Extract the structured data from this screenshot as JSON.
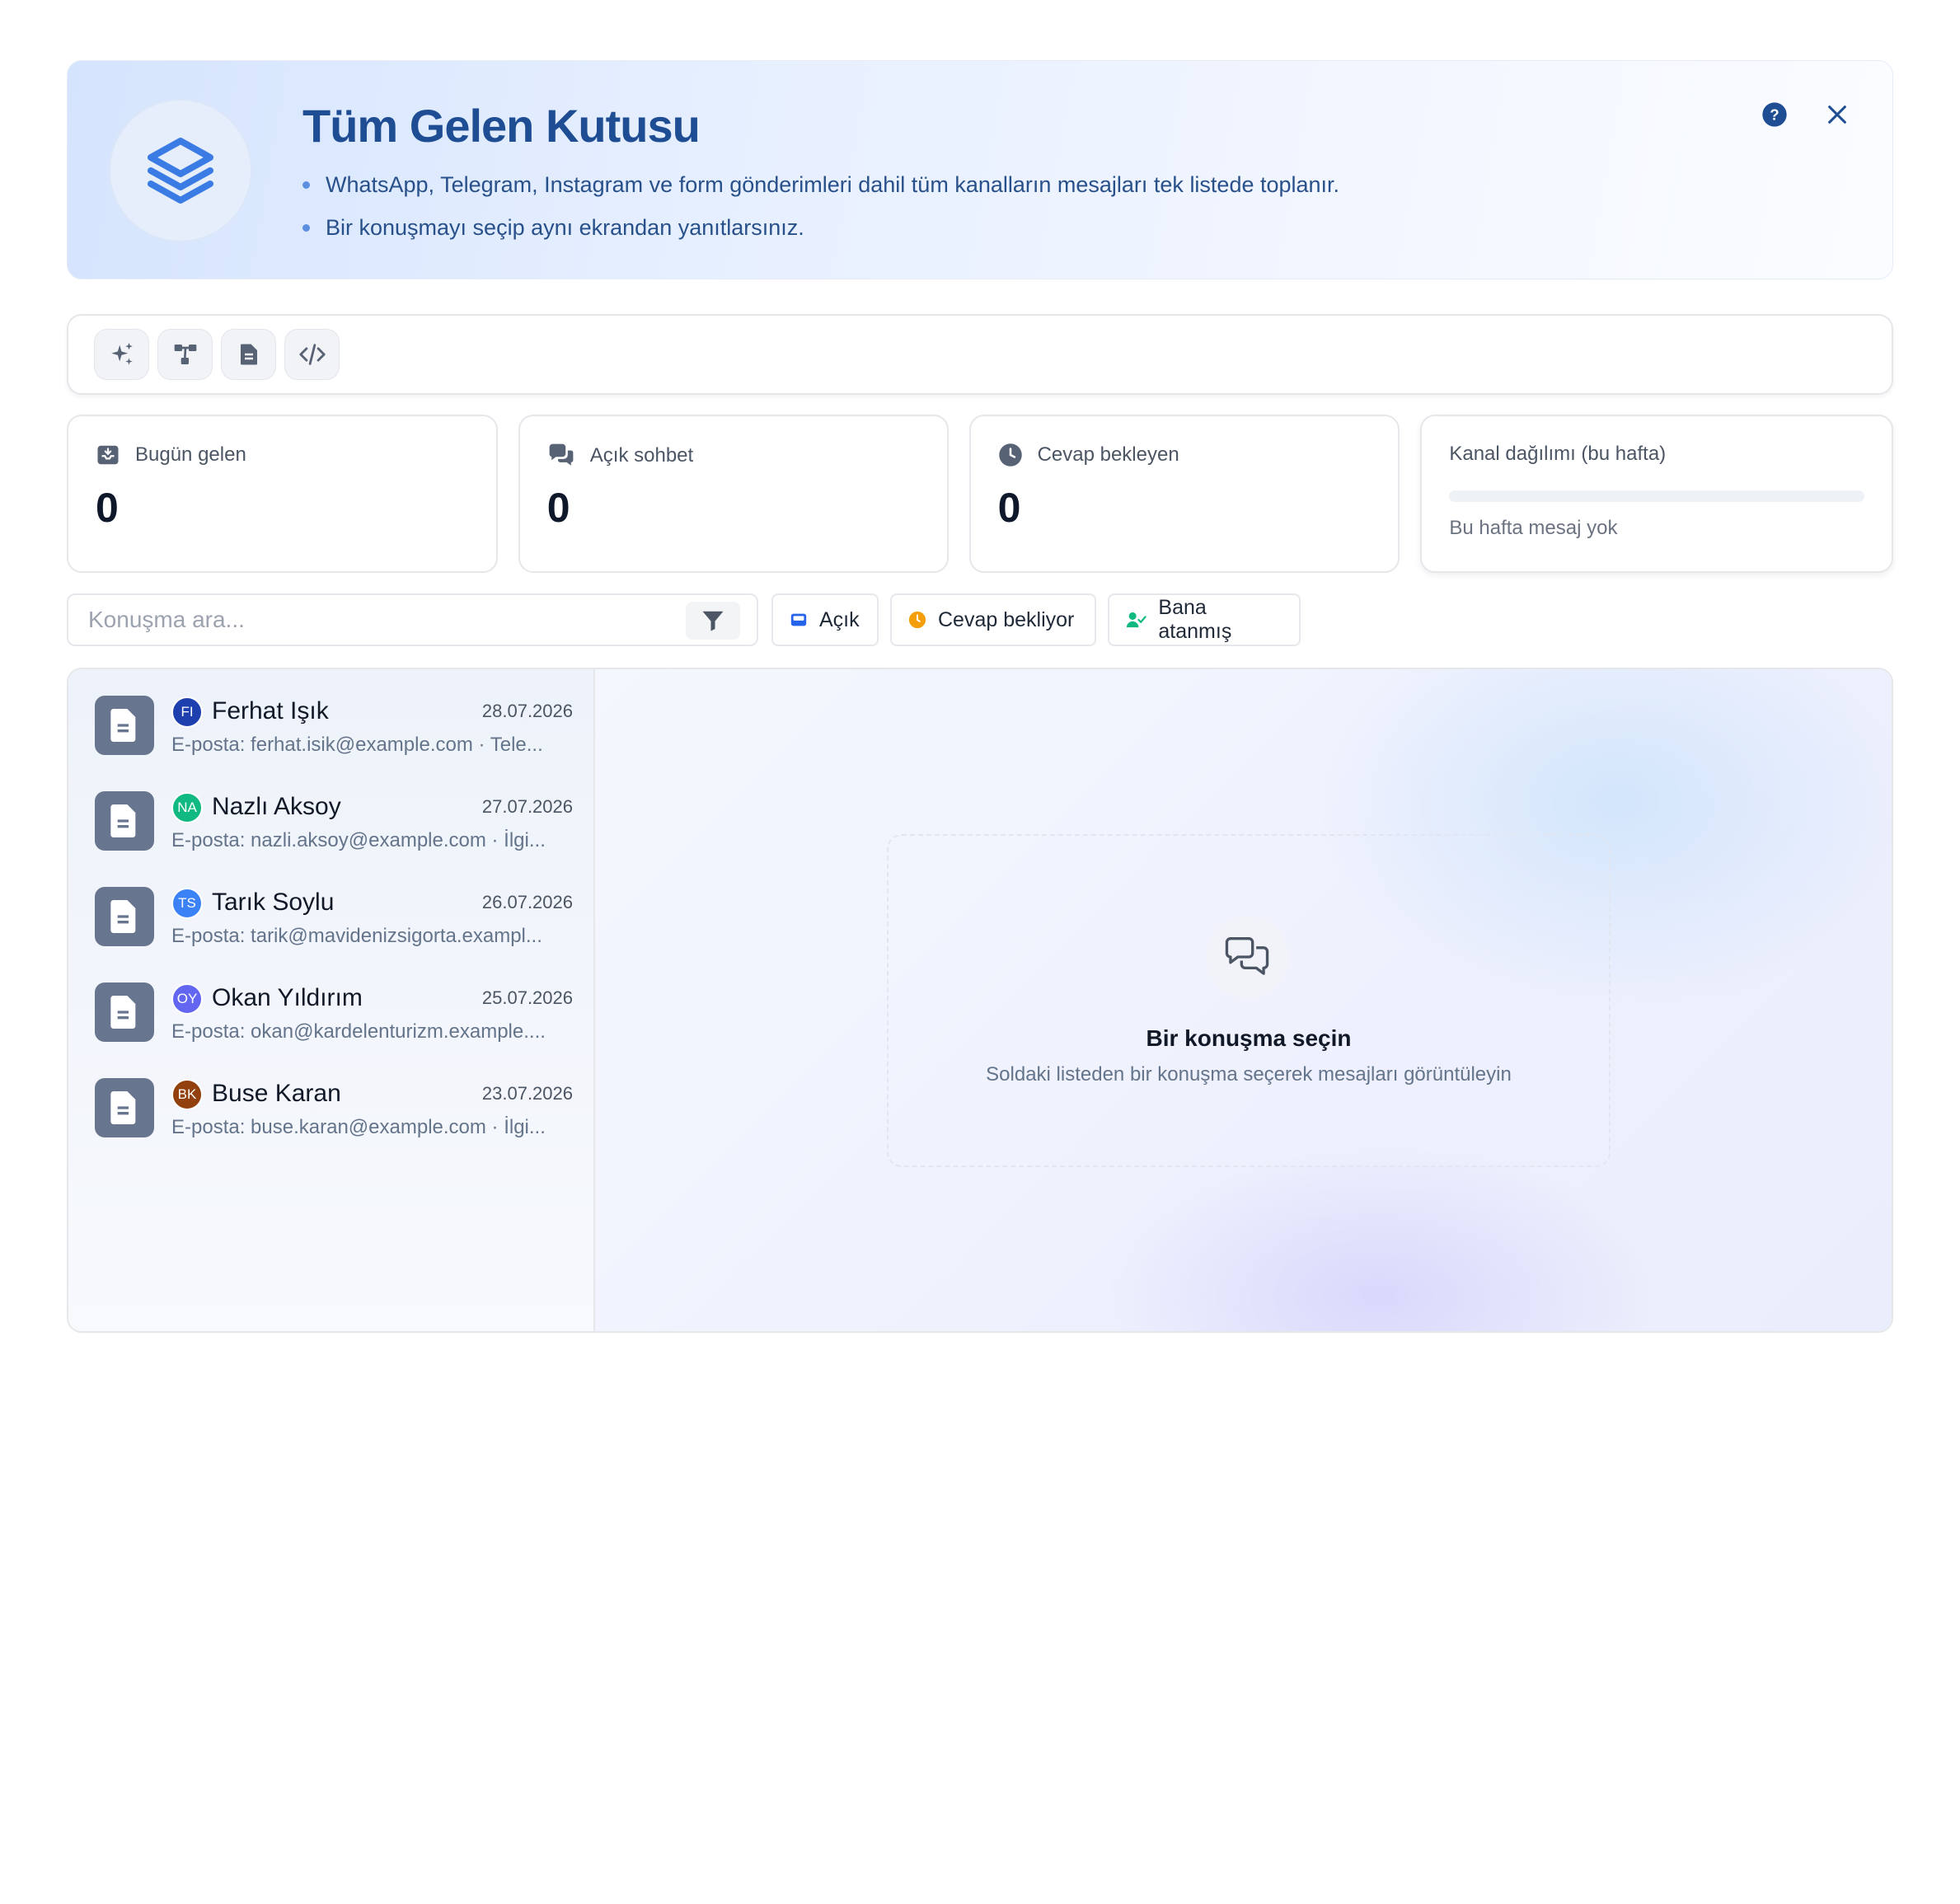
{
  "banner": {
    "title": "Tüm Gelen Kutusu",
    "bullets": [
      "WhatsApp, Telegram, Instagram ve form gönderimleri dahil tüm kanalların mesajları tek listede toplanır.",
      "Bir konuşmayı seçip aynı ekrandan yanıtlarsınız."
    ],
    "logo_icon": "layers-icon",
    "help_icon": "help-circle-icon",
    "close_icon": "close-icon"
  },
  "toolbar": {
    "buttons": [
      {
        "icon": "sparkles-icon"
      },
      {
        "icon": "workflow-icon"
      },
      {
        "icon": "document-icon"
      },
      {
        "icon": "code-icon"
      }
    ]
  },
  "stats": {
    "today": {
      "label": "Bugün gelen",
      "value": "0",
      "icon": "inbox-download-icon"
    },
    "open": {
      "label": "Açık sohbet",
      "value": "0",
      "icon": "chat-bubbles-icon"
    },
    "waiting": {
      "label": "Cevap bekleyen",
      "value": "0",
      "icon": "clock-icon"
    },
    "channel": {
      "label": "Kanal dağılımı (bu hafta)",
      "empty_text": "Bu hafta mesaj yok"
    }
  },
  "filters": {
    "search_placeholder": "Konuşma ara...",
    "chips": [
      {
        "label": "Açık",
        "icon": "inbox-icon",
        "color": "#2563eb"
      },
      {
        "label": "Cevap bekliyor",
        "icon": "clock-dot-icon",
        "color": "#f59e0b"
      },
      {
        "label": "Bana atanmış",
        "icon": "user-check-icon",
        "color": "#10b981"
      }
    ]
  },
  "conversations": [
    {
      "initials": "FI",
      "avatar_color": "#1e40af",
      "name": "Ferhat Işık",
      "date": "28.07.2026",
      "preview": "E-posta: ferhat.isik@example.com · Tele..."
    },
    {
      "initials": "NA",
      "avatar_color": "#10b981",
      "name": "Nazlı Aksoy",
      "date": "27.07.2026",
      "preview": "E-posta: nazli.aksoy@example.com · İlgi..."
    },
    {
      "initials": "TS",
      "avatar_color": "#3b82f6",
      "name": "Tarık Soylu",
      "date": "26.07.2026",
      "preview": "E-posta: tarik@mavidenizsigorta.exampl..."
    },
    {
      "initials": "OY",
      "avatar_color": "#6366f1",
      "name": "Okan Yıldırım",
      "date": "25.07.2026",
      "preview": "E-posta: okan@kardelenturizm.example...."
    },
    {
      "initials": "BK",
      "avatar_color": "#92400e",
      "name": "Buse Karan",
      "date": "23.07.2026",
      "preview": "E-posta: buse.karan@example.com · İlgi..."
    }
  ],
  "detail": {
    "empty_title": "Bir konuşma seçin",
    "empty_subtitle": "Soldaki listeden bir konuşma seçerek mesajları görüntüleyin",
    "empty_icon": "chat-outline-icon"
  }
}
